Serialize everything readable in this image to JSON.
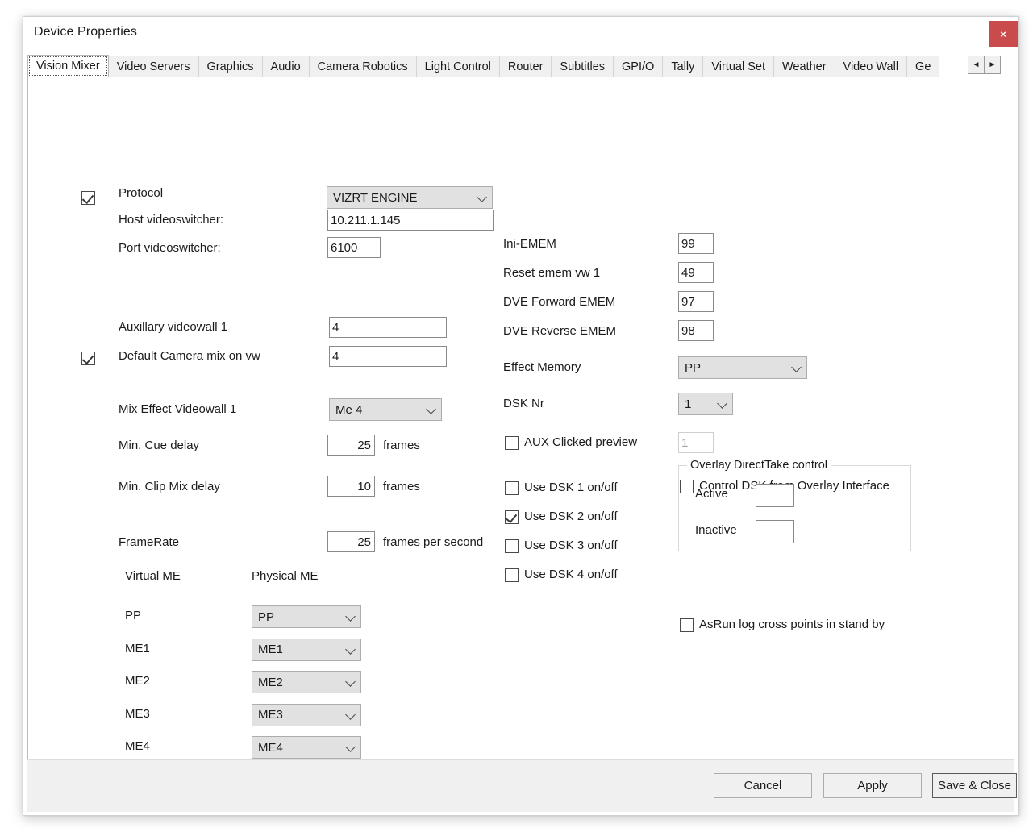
{
  "window": {
    "title": "Device Properties",
    "close_label": "×"
  },
  "tabs": {
    "items": [
      {
        "label": "Vision Mixer",
        "selected": true
      },
      {
        "label": "Video Servers",
        "selected": false
      },
      {
        "label": "Graphics",
        "selected": false
      },
      {
        "label": "Audio",
        "selected": false
      },
      {
        "label": "Camera Robotics",
        "selected": false
      },
      {
        "label": "Light Control",
        "selected": false
      },
      {
        "label": "Router",
        "selected": false
      },
      {
        "label": "Subtitles",
        "selected": false
      },
      {
        "label": "GPI/O",
        "selected": false
      },
      {
        "label": "Tally",
        "selected": false
      },
      {
        "label": "Virtual Set",
        "selected": false
      },
      {
        "label": "Weather",
        "selected": false
      },
      {
        "label": "Video Wall",
        "selected": false
      },
      {
        "label": "Ge",
        "selected": false
      }
    ],
    "scroll_left": "◄",
    "scroll_right": "►"
  },
  "form": {
    "protocol": {
      "checkbox_checked": true,
      "label": "Protocol",
      "value": "VIZRT ENGINE"
    },
    "host": {
      "label": "Host videoswitcher:",
      "value": "10.211.1.145"
    },
    "port": {
      "label": "Port videoswitcher:",
      "value": "6100"
    },
    "aux_videowall": {
      "label": "Auxillary videowall 1",
      "value": "4"
    },
    "default_camera_mix": {
      "checkbox_checked": true,
      "label": "Default Camera mix on vw",
      "value": "4"
    },
    "mix_effect_videowall": {
      "label": "Mix Effect Videowall 1",
      "value": "Me 4"
    },
    "min_cue_delay": {
      "label": "Min. Cue delay",
      "value": "25",
      "unit": "frames"
    },
    "min_clip_mix_delay": {
      "label": "Min. Clip Mix delay",
      "value": "10",
      "unit": "frames"
    },
    "framerate": {
      "label": "FrameRate",
      "value": "25",
      "unit": "frames per second"
    },
    "me_table": {
      "header_virtual": "Virtual ME",
      "header_physical": "Physical ME",
      "rows": [
        {
          "virtual": "PP",
          "physical": "PP"
        },
        {
          "virtual": "ME1",
          "physical": "ME1"
        },
        {
          "virtual": "ME2",
          "physical": "ME2"
        },
        {
          "virtual": "ME3",
          "physical": "ME3"
        },
        {
          "virtual": "ME4",
          "physical": "ME4"
        }
      ]
    },
    "ini_emem": {
      "label": "Ini-EMEM",
      "value": "99"
    },
    "reset_emem": {
      "label": "Reset emem vw 1",
      "value": "49"
    },
    "dve_forward": {
      "label": "DVE Forward EMEM",
      "value": "97"
    },
    "dve_reverse": {
      "label": "DVE Reverse EMEM",
      "value": "98"
    },
    "effect_memory": {
      "label": "Effect Memory",
      "value": "PP"
    },
    "dsk_nr": {
      "label": "DSK Nr",
      "value": "1"
    },
    "aux_clicked_preview": {
      "checkbox_checked": false,
      "label": "AUX Clicked preview",
      "value": "1",
      "disabled": true
    },
    "dsk_toggles": [
      {
        "label": "Use DSK 1 on/off",
        "checked": false
      },
      {
        "label": "Use DSK 2 on/off",
        "checked": true
      },
      {
        "label": "Use DSK 3 on/off",
        "checked": false
      },
      {
        "label": "Use DSK 4 on/off",
        "checked": false
      }
    ],
    "control_dsk_overlay": {
      "checkbox_checked": false,
      "label": "Control DSK from Overlay Interface"
    },
    "overlay_group": {
      "title": "Overlay DirectTake control",
      "active_label": "Active",
      "active_value": "",
      "inactive_label": "Inactive",
      "inactive_value": ""
    },
    "asrun_log": {
      "checkbox_checked": false,
      "label": "AsRun log cross points in stand by"
    }
  },
  "footer": {
    "cancel": "Cancel",
    "apply": "Apply",
    "save_close": "Save & Close"
  }
}
